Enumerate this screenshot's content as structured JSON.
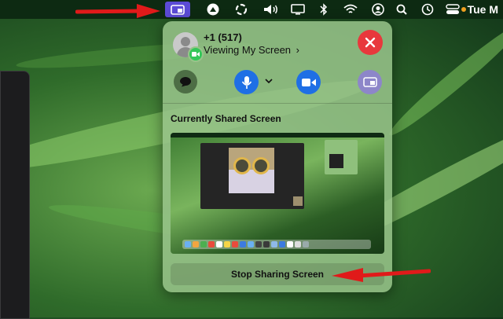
{
  "menubar": {
    "clock": "Tue M",
    "icons": [
      "screen-sharing-icon",
      "airplay-icon",
      "focus-icon",
      "volume-icon",
      "display-icon",
      "bluetooth-icon",
      "wifi-icon",
      "user-icon",
      "search-icon",
      "time-machine-icon",
      "control-center-icon"
    ]
  },
  "call": {
    "caller_name": "+1 (517)",
    "status": "Viewing My Screen",
    "status_chevron": "›"
  },
  "shared": {
    "section_title": "Currently Shared Screen",
    "stop_button": "Stop Sharing Screen"
  },
  "colors": {
    "accent_active": "#5b4bd6",
    "close": "#e8383c",
    "blue": "#1f6fe5",
    "arrow": "#e01a1a"
  }
}
